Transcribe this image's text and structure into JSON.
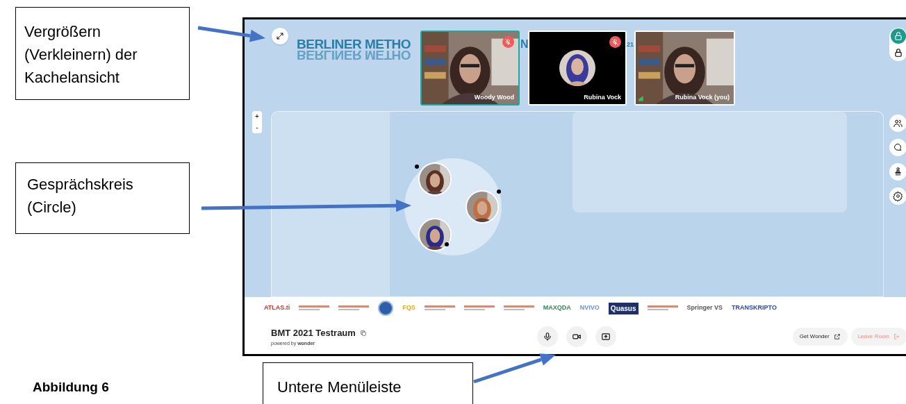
{
  "annotations": [
    {
      "text": "Vergrößern (Verkleinern) der Kachelansicht"
    },
    {
      "text": "Gesprächskreis (Circle)"
    },
    {
      "text": "Untere Menüleiste"
    }
  ],
  "caption": "Abbildung 6",
  "screen": {
    "banner": {
      "text": "BERLINER METHO",
      "reflection": "BERLINER METHO",
      "fragment_1": "N",
      "fragment_2": "21"
    },
    "videos": [
      {
        "name": "Woody Wood",
        "muted": true,
        "speaking": true,
        "camera": true
      },
      {
        "name": "Rubina Vock",
        "muted": true,
        "speaking": false,
        "camera": false
      },
      {
        "name": "Rubina Vock (you)",
        "muted": false,
        "speaking": false,
        "camera": true
      }
    ],
    "lock_toggle": [
      {
        "kind": "unlocked",
        "selected": true
      },
      {
        "kind": "locked",
        "selected": false
      }
    ],
    "zoom": {
      "plus": "+",
      "minus": "-"
    },
    "side_buttons": [
      {
        "kind": "people"
      },
      {
        "kind": "chat"
      },
      {
        "kind": "presenter"
      },
      {
        "kind": "settings"
      }
    ],
    "circle": {
      "members": [
        {
          "kind": "a"
        },
        {
          "kind": "b"
        },
        {
          "kind": "c"
        }
      ]
    },
    "logos": [
      {
        "kind": "text",
        "text": "ATLAS.ti",
        "color": "#c0392b"
      },
      {
        "kind": "graphic"
      },
      {
        "kind": "graphic"
      },
      {
        "kind": "round"
      },
      {
        "kind": "text",
        "text": "FQS",
        "color": "#e6a817"
      },
      {
        "kind": "graphic"
      },
      {
        "kind": "graphic"
      },
      {
        "kind": "graphic"
      },
      {
        "kind": "text",
        "text": "MAXQDA",
        "color": "#2e8b57"
      },
      {
        "kind": "text",
        "text": "NVIVO",
        "color": "#6a8fd8"
      },
      {
        "kind": "boxed",
        "text": "Quasus",
        "color": "#1f2f6e"
      },
      {
        "kind": "graphic"
      },
      {
        "kind": "text",
        "text": "Springer VS",
        "color": "#555555"
      },
      {
        "kind": "text",
        "text": "TRANSKRIPTO",
        "color": "#2b4a9b"
      }
    ],
    "room": {
      "title": "BMT 2021 Testraum",
      "powered_by": "powered by **wonder**"
    },
    "controls": [
      {
        "kind": "mic"
      },
      {
        "kind": "camera"
      },
      {
        "kind": "share"
      }
    ],
    "buttons": [
      {
        "kind": "plain",
        "label": "Get Wonder"
      },
      {
        "kind": "danger",
        "label": "Leave Room"
      }
    ]
  }
}
